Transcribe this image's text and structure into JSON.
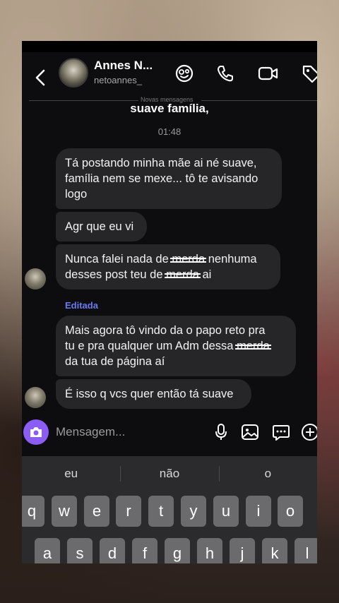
{
  "header": {
    "contact_name": "Annes N...",
    "username": "netoannes_"
  },
  "chat": {
    "separator_text": "Novas mensagens",
    "cut_message": "suave família,",
    "timestamp": "01:48",
    "messages": [
      {
        "text": "Tá postando minha mãe ai né suave, família nem se mexe... tô te avisando logo"
      },
      {
        "text": "Agr que eu vi"
      },
      {
        "line1_a": "Nunca falei nada de ",
        "line1_censored": "merda",
        "line1_b": " nenhuma",
        "line2_a": "desses post teu de ",
        "line2_censored": "merda",
        "line2_b": " ai"
      },
      {
        "line1": "Mais agora tô vindo da o papo reto pra",
        "line2_a": "tu e pra qualquer um Adm dessa ",
        "line2_censored": "merda",
        "line3": "da tua de página aí"
      },
      {
        "text": "É isso q vcs quer então tá suave"
      }
    ],
    "edited_label": "Editada"
  },
  "composer": {
    "placeholder": "Mensagem..."
  },
  "keyboard": {
    "suggestions": [
      "eu",
      "não",
      "o"
    ],
    "row1": [
      "q",
      "w",
      "e",
      "r",
      "t",
      "y",
      "u",
      "i",
      "o"
    ],
    "row2": [
      "a",
      "s",
      "d",
      "f",
      "g",
      "h",
      "j",
      "k",
      "l"
    ]
  },
  "colors": {
    "accent": "#8b5cf6",
    "edited": "#6b7cf0",
    "bubble": "#262629",
    "background": "#0d0d0f"
  },
  "icons": [
    "back-icon",
    "sticker-icon",
    "phone-icon",
    "video-icon",
    "tag-icon",
    "camera-icon",
    "mic-icon",
    "image-icon",
    "chat-bubble-icon",
    "plus-icon"
  ]
}
